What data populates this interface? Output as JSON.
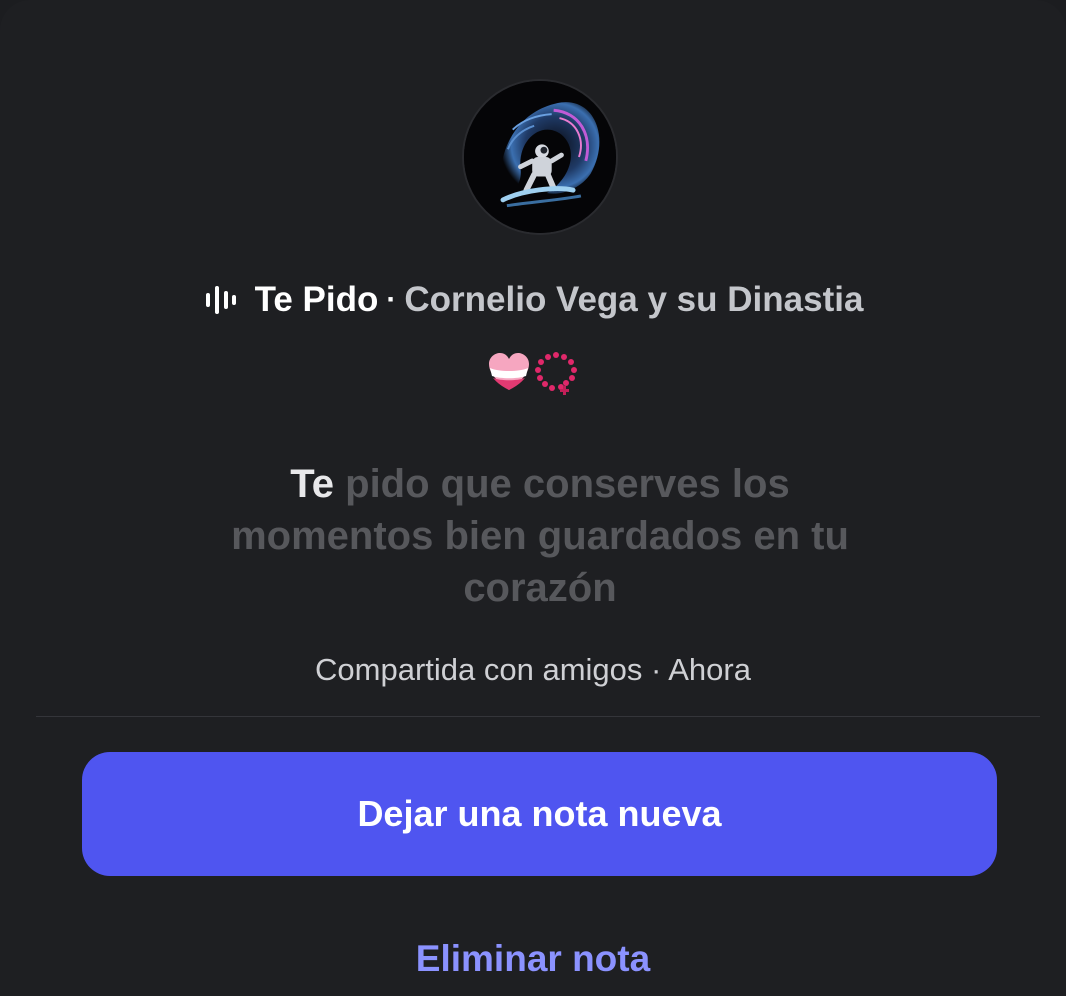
{
  "note": {
    "avatar_icon": "astronaut-surfer-avatar",
    "song": {
      "icon": "audio-waveform-icon",
      "title": "Te Pido",
      "separator": "·",
      "artist": "Cornelio Vega y su Dinastia"
    },
    "emojis": [
      "heart-with-band-emoji",
      "rosary-emoji"
    ],
    "lyrics": {
      "active_word": "Te",
      "rest": " pido que conserves los momentos bien guardados en tu corazón"
    },
    "meta": "Compartida con amigos · Ahora"
  },
  "actions": {
    "new_note_label": "Dejar una nota nueva",
    "delete_note_label": "Eliminar nota"
  },
  "colors": {
    "background": "#1e1f22",
    "primary_button": "#4f55f0",
    "link": "#8b92ff"
  }
}
